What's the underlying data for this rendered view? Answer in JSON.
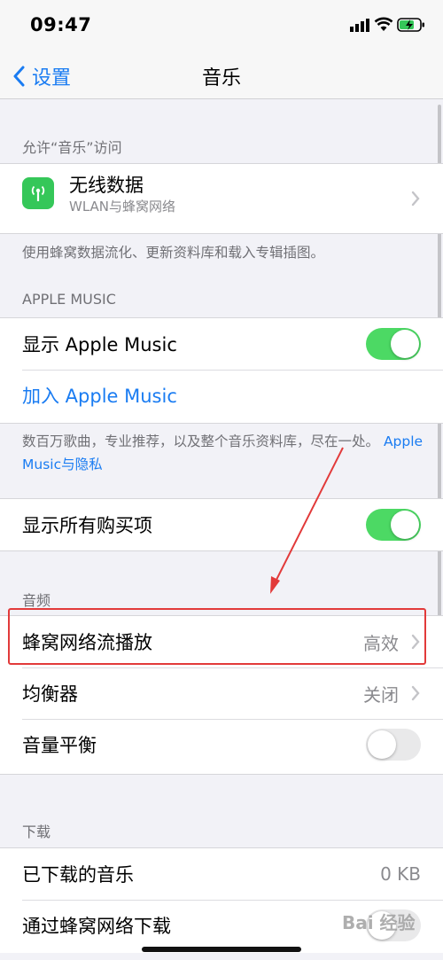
{
  "status": {
    "time": "09:47"
  },
  "nav": {
    "back_label": "设置",
    "title": "音乐"
  },
  "sections": {
    "access_header": "允许“音乐”访问",
    "wireless": {
      "title": "无线数据",
      "subtitle": "WLAN与蜂窝网络"
    },
    "access_note": "使用蜂窝数据流化、更新资料库和载入专辑插图。",
    "apple_music_header": "APPLE MUSIC",
    "show_apple_music": {
      "label": "显示 Apple Music",
      "on": true
    },
    "join_apple_music": "加入 Apple Music",
    "apple_music_note": "数百万歌曲，专业推荐，以及整个音乐资料库，尽在一处。",
    "apple_music_note_link": "Apple Music与隐私",
    "show_purchases": {
      "label": "显示所有购买项",
      "on": true
    },
    "audio_header": "音频",
    "cellular_streaming": {
      "label": "蜂窝网络流播放",
      "value": "高效"
    },
    "eq": {
      "label": "均衡器",
      "value": "关闭"
    },
    "sound_check": {
      "label": "音量平衡",
      "on": false
    },
    "downloads_header": "下载",
    "downloaded_music": {
      "label": "已下载的音乐",
      "value": "0 KB"
    },
    "cellular_download": {
      "label": "通过蜂窝网络下载"
    }
  },
  "watermark": "Bai 经验",
  "colors": {
    "accent": "#1a7cf2",
    "toggle_on": "#4cd964",
    "annotation": "#e23a3a",
    "app_icon": "#35c759"
  },
  "icons": [
    "signal-icon",
    "wifi-icon",
    "battery-charging-icon",
    "back-chevron-icon",
    "antenna-icon",
    "chevron-right-icon"
  ]
}
